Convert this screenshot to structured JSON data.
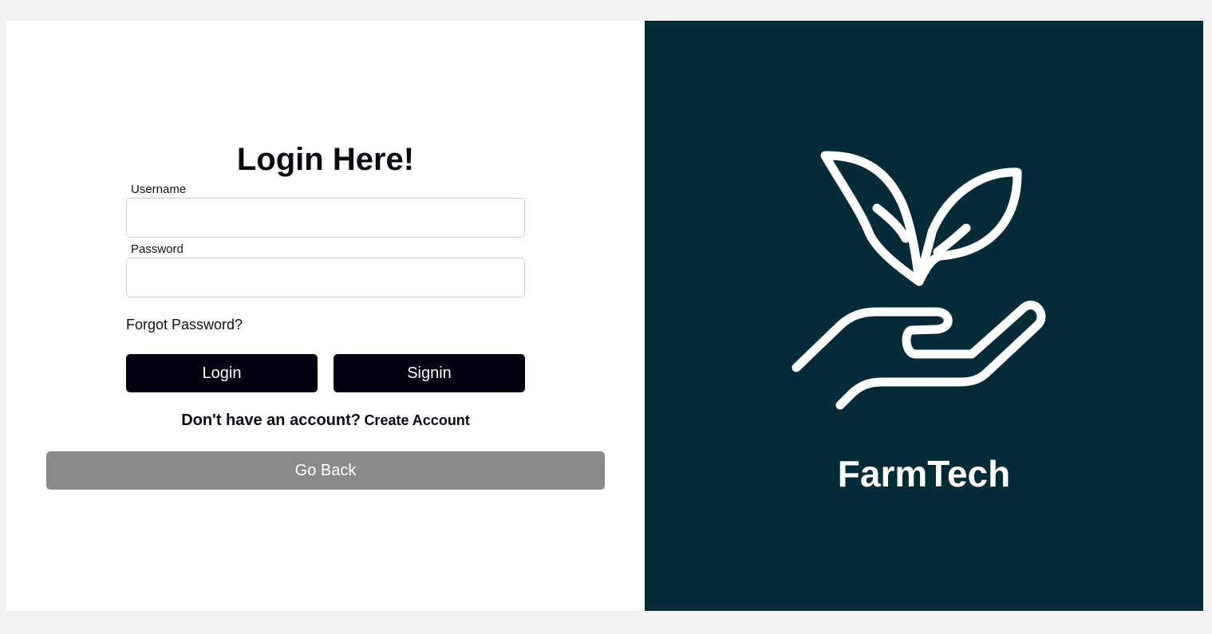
{
  "login": {
    "title": "Login Here!",
    "username_label": "Username",
    "username_value": "",
    "password_label": "Password",
    "password_value": "",
    "forgot_password": "Forgot Password?",
    "login_button": "Login",
    "signin_button": "Signin",
    "no_account_text": "Don't have an account?",
    "create_account_link": "Create Account",
    "go_back_button": "Go Back"
  },
  "brand": {
    "name": "FarmTech",
    "icon": "hand-plant-icon"
  },
  "colors": {
    "brand_panel": "#032b38",
    "primary_button": "#03010f",
    "secondary_button": "#8a8a8a"
  }
}
